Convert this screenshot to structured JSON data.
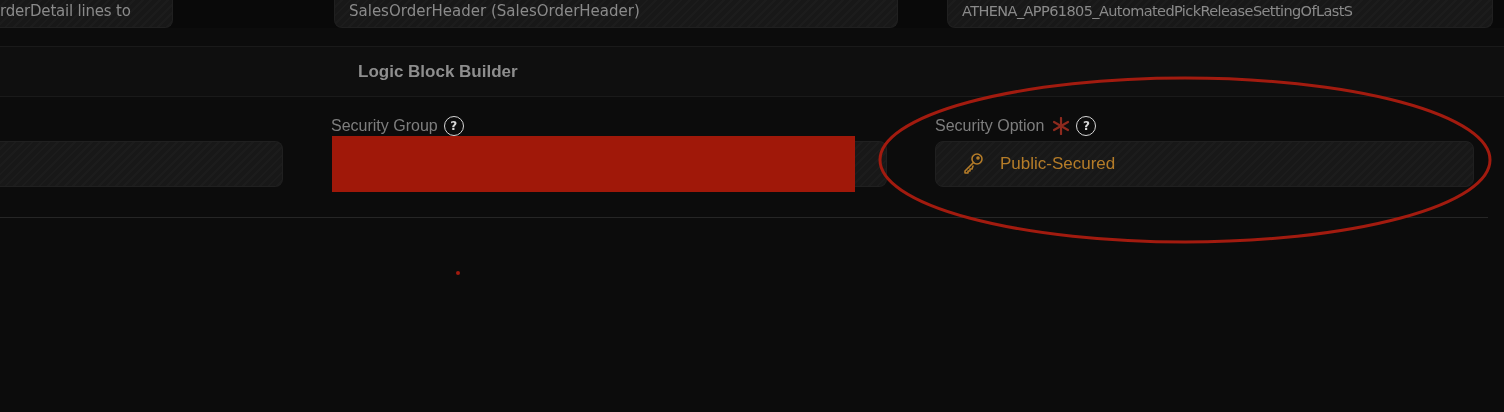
{
  "top_fields": [
    {
      "value": "rderDetail lines to"
    },
    {
      "value": "SalesOrderHeader (SalesOrderHeader)"
    },
    {
      "value": "ATHENA_APP61805_AutomatedPickReleaseSettingOfLastS"
    }
  ],
  "section_title": "Logic Block Builder",
  "fields": [
    {
      "kind": "blank"
    },
    {
      "kind": "redacted",
      "label": "Security Group",
      "help": "?"
    },
    {
      "kind": "option",
      "label": "Security Option",
      "required": true,
      "help": "?",
      "value": "Public-Secured"
    }
  ],
  "highlight_ellipse": true,
  "marker_dot": true
}
